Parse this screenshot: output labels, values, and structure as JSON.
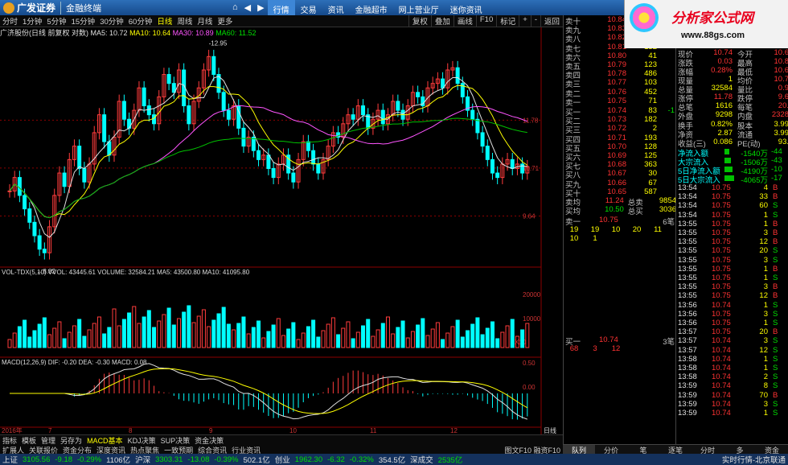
{
  "app": {
    "brand": "广发证券",
    "product": "金融终端"
  },
  "nav": [
    "行情",
    "交易",
    "资讯",
    "金融超市",
    "网上营业厅",
    "迷你资讯"
  ],
  "ad": {
    "title": "分析家公式网",
    "url": "www.88gs.com"
  },
  "toolbar": {
    "periods": [
      "分时",
      "1分钟",
      "5分钟",
      "15分钟",
      "30分钟",
      "60分钟",
      "日线",
      "周线",
      "月线",
      "更多"
    ],
    "selected": "日线",
    "right": [
      "复权",
      "叠加",
      "画线",
      "F10",
      "标记",
      "+",
      "-",
      "返回"
    ]
  },
  "stock": {
    "header": "广济股份(日线 前复权 对数)",
    "ma5": "MA5: 10.72",
    "ma10": "MA10: 10.64",
    "ma30": "MA30: 10.89",
    "ma60": "MA60: 11.52"
  },
  "price_axis": [
    "11.78",
    "10.71",
    "9.64"
  ],
  "annotations": {
    "high": "12.95",
    "low": "8.82"
  },
  "volume": {
    "header": "VOL-TDX(5,10)",
    "vvol": "VVOL: 43445.61",
    "volume": "VOLUME: 32584.21",
    "ma5": "MA5: 43500.80",
    "ma10": "MA10: 41095.80",
    "axis": [
      "20000",
      "10000"
    ],
    "unit": "X10"
  },
  "macd": {
    "header": "MACD(12,26,9)",
    "dif": "DIF: -0.20",
    "dea": "DEA: -0.30",
    "macd": "MACD: 0.08",
    "axis": [
      "0.50",
      "0.00"
    ]
  },
  "date_axis": {
    "year": "2016年",
    "months": [
      "7",
      "8",
      "9",
      "10",
      "11",
      "12"
    ],
    "period": "日线"
  },
  "bottom_tabs": {
    "row1": [
      "指标",
      "模板",
      "管理",
      "另存为",
      "MACD基本",
      "KDJ决策",
      "SUP决策",
      "资金决策"
    ],
    "row2": [
      "扩展人",
      "关联报价",
      "资金分布",
      "深度资讯",
      "热点聚焦",
      "一致预期",
      "综合资讯",
      "行业资讯"
    ],
    "right": [
      "图文F10",
      "融资F10"
    ]
  },
  "quote": {
    "sell": [
      {
        "l": "卖十",
        "p": "10.84",
        "v": "9",
        "d": ""
      },
      {
        "l": "卖九",
        "p": "10.83",
        "v": "8",
        "d": ""
      },
      {
        "l": "卖八",
        "p": "10.82",
        "v": "5",
        "d": ""
      },
      {
        "l": "卖七",
        "p": "10.81",
        "v": "132",
        "d": ""
      },
      {
        "l": "卖六",
        "p": "10.80",
        "v": "41",
        "d": ""
      },
      {
        "l": "卖五",
        "p": "10.79",
        "v": "123",
        "d": ""
      },
      {
        "l": "卖四",
        "p": "10.78",
        "v": "486",
        "d": ""
      },
      {
        "l": "卖三",
        "p": "10.77",
        "v": "103",
        "d": ""
      },
      {
        "l": "卖二",
        "p": "10.76",
        "v": "452",
        "d": ""
      },
      {
        "l": "卖一",
        "p": "10.75",
        "v": "71",
        "d": ""
      }
    ],
    "buy": [
      {
        "l": "买一",
        "p": "10.74",
        "v": "83",
        "d": "-1"
      },
      {
        "l": "买二",
        "p": "10.73",
        "v": "182",
        "d": ""
      },
      {
        "l": "买三",
        "p": "10.72",
        "v": "2",
        "d": ""
      },
      {
        "l": "买四",
        "p": "10.71",
        "v": "193",
        "d": ""
      },
      {
        "l": "买五",
        "p": "10.70",
        "v": "128",
        "d": ""
      },
      {
        "l": "买六",
        "p": "10.69",
        "v": "125",
        "d": ""
      },
      {
        "l": "买七",
        "p": "10.68",
        "v": "363",
        "d": ""
      },
      {
        "l": "买八",
        "p": "10.67",
        "v": "30",
        "d": ""
      },
      {
        "l": "买九",
        "p": "10.66",
        "v": "67",
        "d": ""
      },
      {
        "l": "买十",
        "p": "10.65",
        "v": "587",
        "d": ""
      }
    ],
    "avg_sell": {
      "l": "卖均",
      "p": "11.24",
      "k": "总卖",
      "v": "9854"
    },
    "avg_buy": {
      "l": "买均",
      "p": "10.50",
      "k": "总买",
      "v": "3036"
    },
    "sell1_detail": {
      "label": "卖一",
      "price": "10.75",
      "count": "6笔",
      "queue1": [
        "19",
        "19",
        "10",
        "20",
        "11"
      ],
      "queue2": [
        "10",
        "1"
      ]
    },
    "buy1_detail": {
      "label": "买一",
      "price": "10.74",
      "count": "3笔",
      "queue": [
        "68",
        "3",
        "12"
      ]
    }
  },
  "info": {
    "rows": [
      [
        "现价",
        "10.74",
        "今开",
        "10.6"
      ],
      [
        "涨跌",
        "0.03",
        "最高",
        "10.8"
      ],
      [
        "涨幅",
        "0.28%",
        "最低",
        "10.6"
      ],
      [
        "现量",
        "1",
        "均价",
        "10.7"
      ],
      [
        "总量",
        "32584",
        "量比",
        "0.9"
      ],
      [
        "涨停",
        "11.78",
        "跌停",
        "9.6"
      ],
      [
        "总笔",
        "1616",
        "每笔",
        "20."
      ],
      [
        "外盘",
        "9298",
        "内盘",
        "2328"
      ]
    ],
    "rows2": [
      [
        "换手",
        "0.82%",
        "股本",
        "3.99"
      ],
      [
        "净资",
        "2.87",
        "流通",
        "3.99"
      ],
      [
        "收益(三)",
        "0.086",
        "PE(动)",
        "93."
      ]
    ],
    "flows": [
      [
        "净流入额",
        "-1540万",
        "-44"
      ],
      [
        "大宗流入",
        "-1506万",
        "-43"
      ],
      [
        "5日净流入额",
        "-4190万",
        "-10"
      ],
      [
        "5日大宗流入",
        "-4065万",
        "-17"
      ]
    ]
  },
  "ticks": [
    [
      "13:54",
      "10.75",
      "4",
      "B"
    ],
    [
      "13:54",
      "10.75",
      "33",
      "B"
    ],
    [
      "13:54",
      "10.75",
      "60",
      "S"
    ],
    [
      "13:54",
      "10.75",
      "1",
      "S"
    ],
    [
      "13:55",
      "10.75",
      "1",
      "B"
    ],
    [
      "13:55",
      "10.75",
      "3",
      "B"
    ],
    [
      "13:55",
      "10.75",
      "12",
      "B"
    ],
    [
      "13:55",
      "10.75",
      "20",
      "S"
    ],
    [
      "13:55",
      "10.75",
      "3",
      "S"
    ],
    [
      "13:55",
      "10.75",
      "1",
      "B"
    ],
    [
      "13:55",
      "10.75",
      "1",
      "S"
    ],
    [
      "13:55",
      "10.75",
      "3",
      "B"
    ],
    [
      "13:55",
      "10.75",
      "12",
      "B"
    ],
    [
      "13:56",
      "10.74",
      "1",
      "S"
    ],
    [
      "13:56",
      "10.75",
      "3",
      "S"
    ],
    [
      "13:56",
      "10.75",
      "1",
      "S"
    ],
    [
      "13:57",
      "10.75",
      "20",
      "B"
    ],
    [
      "13:57",
      "10.74",
      "3",
      "S"
    ],
    [
      "13:57",
      "10.74",
      "12",
      "S"
    ],
    [
      "13:58",
      "10.74",
      "1",
      "S"
    ],
    [
      "13:58",
      "10.74",
      "1",
      "S"
    ],
    [
      "13:58",
      "10.74",
      "2",
      "S"
    ],
    [
      "13:59",
      "10.74",
      "8",
      "S"
    ],
    [
      "13:59",
      "10.74",
      "70",
      "B"
    ],
    [
      "13:59",
      "10.74",
      "3",
      "S"
    ],
    [
      "13:59",
      "10.74",
      "1",
      "S"
    ]
  ],
  "right_tabs": [
    "队列",
    "分价",
    "笔",
    "逐笔",
    "分时",
    "多",
    "资金"
  ],
  "status": [
    {
      "name": "上证",
      "val": "3105.56",
      "chg": "-9.18",
      "pct": "-0.29%",
      "amt": "1106亿"
    },
    {
      "name": "沪深",
      "val": "3303.31",
      "chg": "-13.08",
      "pct": "-0.39%",
      "amt": "502.1亿"
    },
    {
      "name": "创业",
      "val": "1962.30",
      "chg": "-6.32",
      "pct": "-0.32%",
      "amt": "354.5亿"
    },
    {
      "name": "深成交",
      "val": "2535亿",
      "chg": "",
      "pct": "",
      "amt": ""
    }
  ],
  "status_right": "实时行情-北京联通",
  "chart_data": {
    "type": "candlestick",
    "closes": [
      10.2,
      10.5,
      10.1,
      9.8,
      9.5,
      9.2,
      8.9,
      8.82,
      9.4,
      10.1,
      10.6,
      10.3,
      10.9,
      11.2,
      10.7,
      10.4,
      10.8,
      11.5,
      11.9,
      11.3,
      11.0,
      11.4,
      12.2,
      11.8,
      11.6,
      12.0,
      12.5,
      12.1,
      11.9,
      11.7,
      12.3,
      12.8,
      12.6,
      12.4,
      12.9,
      12.1,
      11.7,
      12.2,
      12.5,
      12.9,
      13.2,
      12.8,
      12.4,
      12.0,
      11.8,
      12.1,
      11.6,
      11.2,
      11.4,
      11.1,
      10.9,
      11.0,
      10.7,
      10.5,
      10.8,
      11.0,
      10.6,
      10.4,
      10.9,
      11.3,
      11.1,
      10.8,
      10.6,
      10.9,
      11.2,
      11.5,
      11.4,
      11.7,
      11.9,
      11.8,
      12.1,
      11.9,
      11.6,
      11.8,
      12.0,
      11.7,
      11.9,
      12.2,
      12.0,
      11.8,
      12.1,
      12.4,
      12.3,
      12.1,
      12.5,
      12.6,
      12.7,
      12.5,
      12.9,
      12.95,
      12.6,
      12.3,
      12.0,
      11.8,
      11.5,
      11.2,
      10.9,
      10.6,
      10.5,
      10.8,
      10.9,
      10.7,
      10.8,
      10.6,
      10.74
    ]
  }
}
